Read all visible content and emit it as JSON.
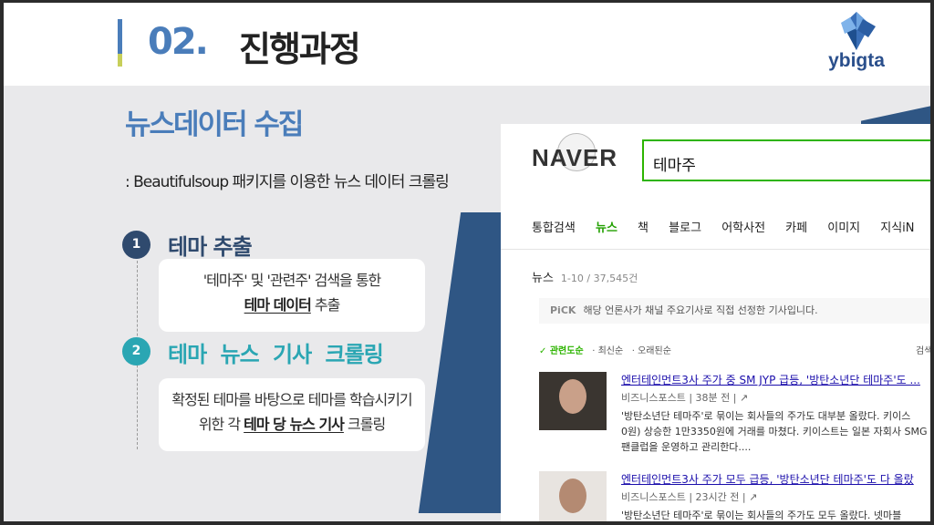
{
  "header": {
    "section_number": "02.",
    "title": "진행과정",
    "logo_text": "ybigta"
  },
  "section": {
    "title": "뉴스데이터 수집",
    "subtitle": ": Beautifulsoup 패키지를 이용한 뉴스 데이터 크롤링"
  },
  "steps": [
    {
      "number": "1",
      "label": "테마 추출",
      "line1": "'테마주' 및 '관련주' 검색을 통한",
      "line2_bold": "테마 데이터",
      "line2_rest": " 추출"
    },
    {
      "number": "2",
      "label": "테마 뉴스 기사 크롤링",
      "line1": "확정된 테마를 바탕으로 테마를 학습시키기",
      "line2_prefix": "위한 각 ",
      "line2_bold": "테마 당 뉴스 기사",
      "line2_rest": " 크롤링"
    }
  ],
  "naver": {
    "logo": "NAVER",
    "query": "테마주",
    "tabs": [
      "통합검색",
      "뉴스",
      "책",
      "블로그",
      "어학사전",
      "카페",
      "이미지",
      "지식iN"
    ],
    "active_tab": "뉴스",
    "news_label": "뉴스",
    "news_count": "1-10 / 37,545건",
    "pick_label": "PiCK",
    "pick_text": "해당 언론사가 채널 주요기사로 직접 선정한 기사입니다.",
    "sort": [
      "✓ 관련도순",
      "· 최신순",
      "· 오래된순"
    ],
    "sort_right": "검색",
    "articles": [
      {
        "title": "엔터테인먼트3사 주가 중 SM JYP 급등, '방탄소년단 테마주'도 ...",
        "source": "비즈니스포스트",
        "time": "38분 전",
        "body1": "'방탄소년단 테마주'로 묶이는 회사들의 주가도 대부분 올랐다. 키이스",
        "body2": "0원) 상승한 1만3350원에 거래를 마쳤다. 키이스트는 일본 자회사 SMG",
        "body3": "팬클럽을 운영하고 관리한다...."
      },
      {
        "title": "엔터테인먼트3사 주가 모두 급등, '방탄소년단 테마주'도 다 올랐",
        "source": "비즈니스포스트",
        "time": "23시간 전",
        "body1": "'방탄소년단 테마주'로 묶이는 회사들의 주가도 모두 올랐다. 넷마블"
      }
    ]
  },
  "colors": {
    "accent_blue": "#4a7dba",
    "step1": "#2f4a6e",
    "step2": "#2aa6b3",
    "naver_green": "#2db400"
  }
}
